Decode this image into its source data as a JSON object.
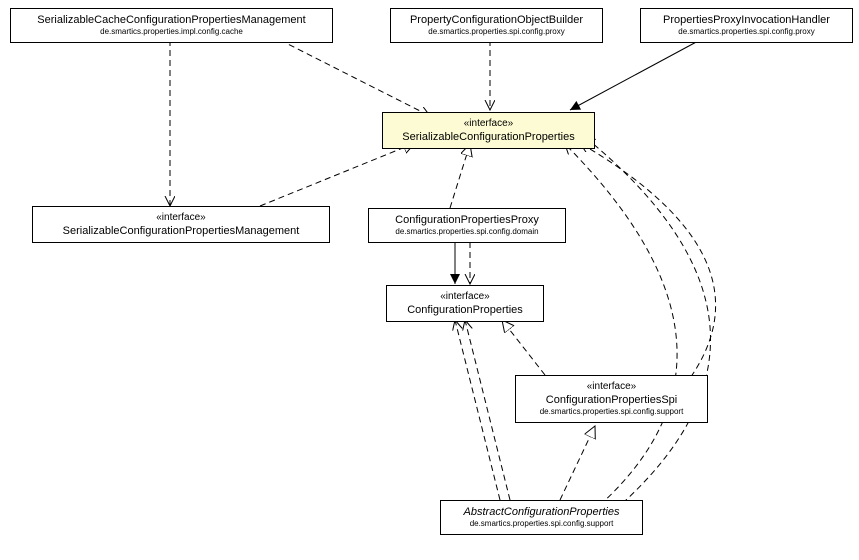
{
  "nodes": {
    "n1": {
      "title": "SerializableCacheConfigurationPropertiesManagement",
      "pkg": "de.smartics.properties.impl.config.cache"
    },
    "n2": {
      "title": "PropertyConfigurationObjectBuilder",
      "pkg": "de.smartics.properties.spi.config.proxy"
    },
    "n3": {
      "title": "PropertiesProxyInvocationHandler",
      "pkg": "de.smartics.properties.spi.config.proxy"
    },
    "n4": {
      "stereo": "«interface»",
      "title": "SerializableConfigurationProperties"
    },
    "n5": {
      "stereo": "«interface»",
      "title": "SerializableConfigurationPropertiesManagement"
    },
    "n6": {
      "title": "ConfigurationPropertiesProxy",
      "pkg": "de.smartics.properties.spi.config.domain"
    },
    "n7": {
      "stereo": "«interface»",
      "title": "ConfigurationProperties"
    },
    "n8": {
      "stereo": "«interface»",
      "title": "ConfigurationPropertiesSpi",
      "pkg": "de.smartics.properties.spi.config.support"
    },
    "n9": {
      "title": "AbstractConfigurationProperties",
      "pkg": "de.smartics.properties.spi.config.support"
    }
  },
  "chart_data": {
    "type": "uml-class-diagram",
    "nodes": [
      {
        "id": "n1",
        "name": "SerializableCacheConfigurationPropertiesManagement",
        "kind": "class",
        "package": "de.smartics.properties.impl.config.cache"
      },
      {
        "id": "n2",
        "name": "PropertyConfigurationObjectBuilder",
        "kind": "class",
        "package": "de.smartics.properties.spi.config.proxy"
      },
      {
        "id": "n3",
        "name": "PropertiesProxyInvocationHandler",
        "kind": "class",
        "package": "de.smartics.properties.spi.config.proxy"
      },
      {
        "id": "n4",
        "name": "SerializableConfigurationProperties",
        "kind": "interface"
      },
      {
        "id": "n5",
        "name": "SerializableConfigurationPropertiesManagement",
        "kind": "interface"
      },
      {
        "id": "n6",
        "name": "ConfigurationPropertiesProxy",
        "kind": "class",
        "package": "de.smartics.properties.spi.config.domain"
      },
      {
        "id": "n7",
        "name": "ConfigurationProperties",
        "kind": "interface"
      },
      {
        "id": "n8",
        "name": "ConfigurationPropertiesSpi",
        "kind": "interface",
        "package": "de.smartics.properties.spi.config.support"
      },
      {
        "id": "n9",
        "name": "AbstractConfigurationProperties",
        "kind": "abstract-class",
        "package": "de.smartics.properties.spi.config.support"
      }
    ],
    "edges": [
      {
        "from": "n1",
        "to": "n5",
        "type": "dependency"
      },
      {
        "from": "n1",
        "to": "n4",
        "type": "dependency"
      },
      {
        "from": "n2",
        "to": "n4",
        "type": "dependency"
      },
      {
        "from": "n3",
        "to": "n4",
        "type": "association"
      },
      {
        "from": "n5",
        "to": "n4",
        "type": "realization"
      },
      {
        "from": "n6",
        "to": "n4",
        "type": "realization"
      },
      {
        "from": "n6",
        "to": "n7",
        "type": "association"
      },
      {
        "from": "n6",
        "to": "n7",
        "type": "dependency"
      },
      {
        "from": "n8",
        "to": "n7",
        "type": "realization"
      },
      {
        "from": "n8",
        "to": "n4",
        "type": "dependency"
      },
      {
        "from": "n9",
        "to": "n7",
        "type": "dependency"
      },
      {
        "from": "n9",
        "to": "n7",
        "type": "dependency"
      },
      {
        "from": "n9",
        "to": "n8",
        "type": "realization"
      },
      {
        "from": "n9",
        "to": "n4",
        "type": "dependency"
      },
      {
        "from": "n9",
        "to": "n4",
        "type": "dependency"
      }
    ]
  }
}
